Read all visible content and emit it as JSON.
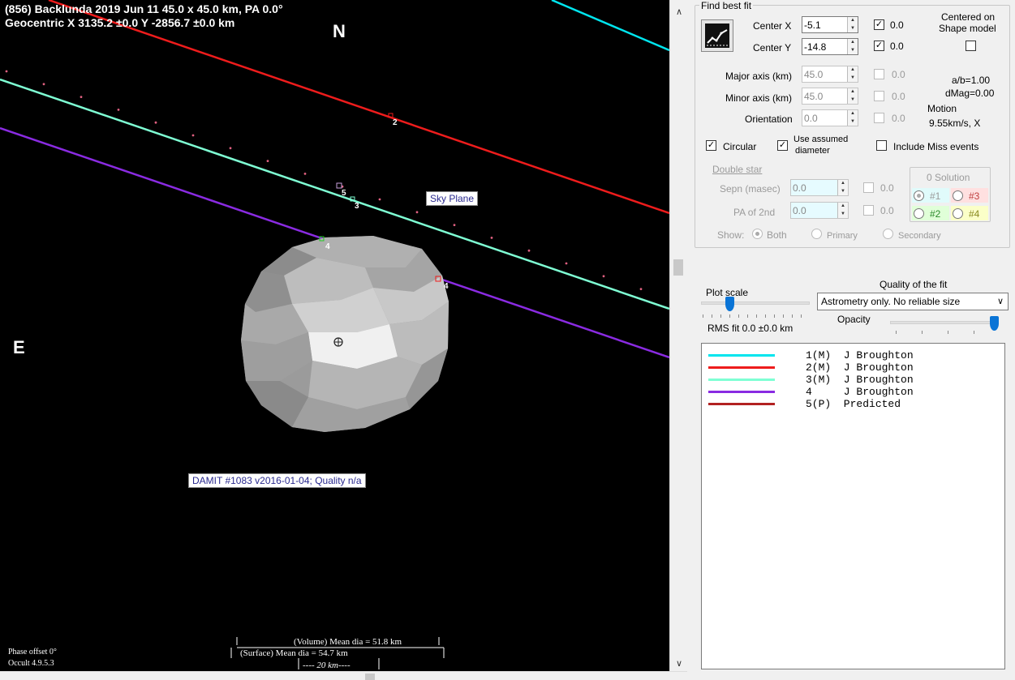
{
  "plot": {
    "title_line1": "(856) Backlunda  2019 Jun 11   45.0 x 45.0 km, PA 0.0°",
    "title_line2": "Geocentric  X  3135.2 ±0.0  Y -2856.7 ±0.0 km",
    "north_label": "N",
    "east_label": "E",
    "sky_plane_label": "Sky Plane",
    "damit_label": "DAMIT #1083 v2016-01-04; Quality n/a",
    "volume_dia": "(Volume) Mean dia = 51.8 km",
    "surface_dia": "(Surface) Mean dia = 54.7 km",
    "scale_bar": "---- 20 km----",
    "phase_offset": "Phase offset 0°",
    "version": "Occult 4.9.5.3",
    "chord_labels": [
      "2",
      "5",
      "3",
      "4",
      "4"
    ]
  },
  "panel": {
    "find_best_fit": "Find best fit",
    "center_x_label": "Center X",
    "center_x_value": "-5.1",
    "center_x_check": "0.0",
    "center_y_label": "Center Y",
    "center_y_value": "-14.8",
    "center_y_check": "0.0",
    "centered_on_line1": "Centered on",
    "centered_on_line2": "Shape model",
    "major_axis_label": "Major axis (km)",
    "major_axis_value": "45.0",
    "major_axis_check": "0.0",
    "minor_axis_label": "Minor axis (km)",
    "minor_axis_value": "45.0",
    "minor_axis_check": "0.0",
    "orientation_label": "Orientation",
    "orientation_value": "0.0",
    "orientation_check": "0.0",
    "ab_ratio": "a/b=1.00",
    "dmag": "dMag=0.00",
    "motion_label": "Motion",
    "motion_value": "9.55km/s, X",
    "circular_label": "Circular",
    "use_assumed_line1": "Use assumed",
    "use_assumed_line2": "diameter",
    "include_miss": "Include Miss events",
    "double_star": "Double star",
    "sepn_label": "Sepn (masec)",
    "sepn_value": "0.0",
    "sepn_check": "0.0",
    "pa2_label": "PA of 2nd",
    "pa2_value": "0.0",
    "pa2_check": "0.0",
    "solution_title": "0 Solution",
    "sol1": "#1",
    "sol2": "#2",
    "sol3": "#3",
    "sol4": "#4",
    "show_label": "Show:",
    "show_both": "Both",
    "show_primary": "Primary",
    "show_secondary": "Secondary",
    "plot_scale": "Plot scale",
    "quality_label": "Quality of the fit",
    "quality_value": "Astrometry only. No reliable size",
    "rms_fit": "RMS fit 0.0 ±0.0 km",
    "opacity": "Opacity",
    "plot_scale_level": 0.23,
    "opacity_level": 0.98
  },
  "observers": [
    {
      "text": "1(M)  J Broughton",
      "color": "#00e5ee"
    },
    {
      "text": "2(M)  J Broughton",
      "color": "#ee1c1c"
    },
    {
      "text": "3(M)  J Broughton",
      "color": "#7fffd4"
    },
    {
      "text": "4     J Broughton",
      "color": "#8a2be2"
    },
    {
      "text": "5(P)  Predicted",
      "color": "#b22222"
    }
  ]
}
